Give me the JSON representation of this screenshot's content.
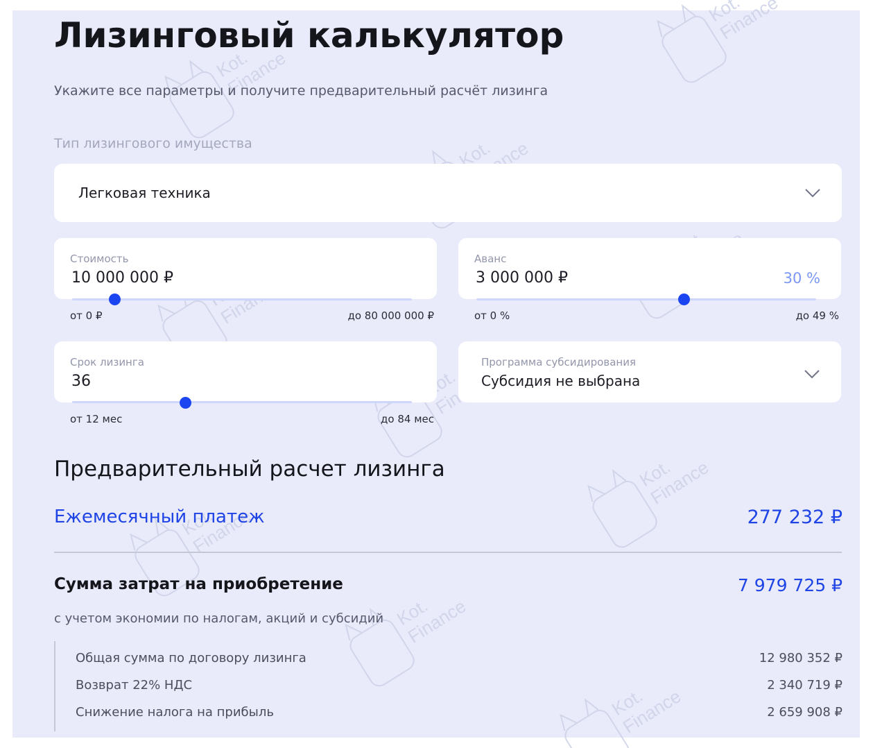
{
  "page": {
    "title": "Лизинговый калькулятор",
    "subtitle": "Укажите все параметры и получите предварительный расчёт лизинга"
  },
  "property_type": {
    "label": "Тип лизингового имущества",
    "value": "Легковая техника",
    "icon": "chevron-down-icon"
  },
  "cost": {
    "label": "Стоимость",
    "value": "10 000 000 ₽",
    "min_label": "от 0 ₽",
    "max_label": "до 80 000 000 ₽",
    "slider_fraction": 0.125
  },
  "advance": {
    "label": "Аванс",
    "value": "3 000 000 ₽",
    "percent": "30 %",
    "min_label": "от 0 %",
    "max_label": "до 49 %",
    "slider_fraction": 0.61
  },
  "term": {
    "label": "Срок лизинга",
    "value": "36",
    "min_label": "от 12 мес",
    "max_label": "до 84 мес",
    "slider_fraction": 0.333
  },
  "subsidy": {
    "label": "Программа субсидирования",
    "value": "Субсидия не выбрана",
    "icon": "chevron-down-icon"
  },
  "result": {
    "heading": "Предварительный расчет лизинга",
    "monthly_label": "Ежемесячный платеж",
    "monthly_value": "277 232 ₽",
    "total_label": "Сумма затрат на приобретение",
    "total_value": "7 979 725 ₽",
    "total_note": "с учетом экономии по налогам, акций и субсидий",
    "breakdown": [
      {
        "label": "Общая сумма по договору лизинга",
        "value": "12 980 352 ₽"
      },
      {
        "label": "Возврат 22% НДС",
        "value": "2 340 719 ₽"
      },
      {
        "label": "Снижение налога на прибыль",
        "value": "2 659 908 ₽"
      }
    ]
  },
  "watermark_text": [
    "Kot.",
    "Finance"
  ],
  "colors": {
    "accent": "#1b45f0",
    "link_blue": "#1f44e6",
    "panel_bg": "#e9ebfb",
    "percent_text": "#7b96f5"
  }
}
